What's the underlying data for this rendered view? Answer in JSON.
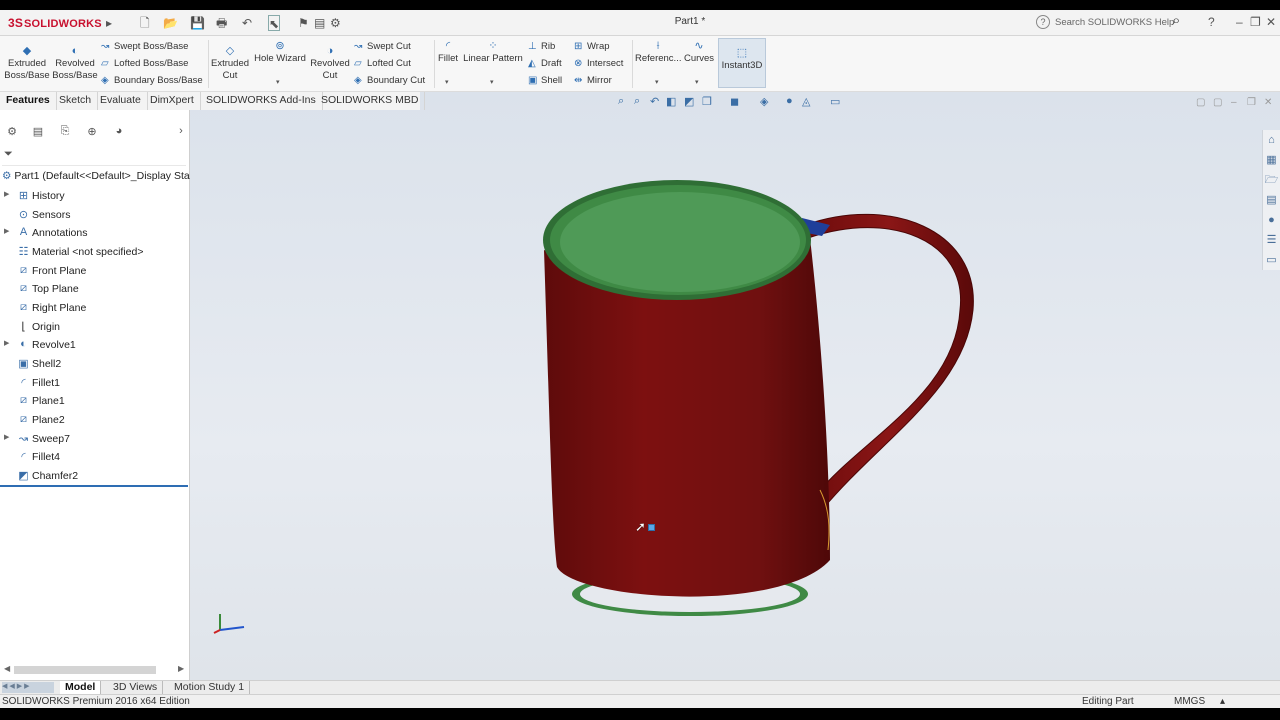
{
  "app": {
    "brand": "SOLIDWORKS",
    "document_title": "Part1 *",
    "help_search_placeholder": "Search SOLIDWORKS Help"
  },
  "ribbon": {
    "extruded_boss": "Extruded Boss/Base",
    "revolved_boss": "Revolved Boss/Base",
    "swept_boss": "Swept Boss/Base",
    "lofted_boss": "Lofted Boss/Base",
    "boundary_boss": "Boundary Boss/Base",
    "extruded_cut": "Extruded Cut",
    "hole_wizard": "Hole Wizard",
    "revolved_cut": "Revolved Cut",
    "swept_cut": "Swept Cut",
    "lofted_cut": "Lofted Cut",
    "boundary_cut": "Boundary Cut",
    "fillet": "Fillet",
    "linear_pattern": "Linear Pattern",
    "rib": "Rib",
    "draft": "Draft",
    "shell": "Shell",
    "wrap": "Wrap",
    "intersect": "Intersect",
    "mirror": "Mirror",
    "reference": "Referenc...",
    "curves": "Curves",
    "instant3d": "Instant3D"
  },
  "tabs": [
    "Features",
    "Sketch",
    "Evaluate",
    "DimXpert",
    "SOLIDWORKS Add-Ins",
    "SOLIDWORKS MBD"
  ],
  "tree": {
    "root": "Part1  (Default<<Default>_Display Sta",
    "items": [
      {
        "label": "History",
        "icon": "history-icon",
        "expandable": true
      },
      {
        "label": "Sensors",
        "icon": "sensor-icon",
        "expandable": false
      },
      {
        "label": "Annotations",
        "icon": "annotation-icon",
        "expandable": true
      },
      {
        "label": "Material <not specified>",
        "icon": "material-icon",
        "expandable": false
      },
      {
        "label": "Front Plane",
        "icon": "plane-icon",
        "expandable": false
      },
      {
        "label": "Top Plane",
        "icon": "plane-icon",
        "expandable": false
      },
      {
        "label": "Right Plane",
        "icon": "plane-icon",
        "expandable": false
      },
      {
        "label": "Origin",
        "icon": "origin-icon",
        "expandable": false
      },
      {
        "label": "Revolve1",
        "icon": "revolve-icon",
        "expandable": true
      },
      {
        "label": "Shell2",
        "icon": "shell-icon",
        "expandable": false
      },
      {
        "label": "Fillet1",
        "icon": "fillet-icon",
        "expandable": false
      },
      {
        "label": "Plane1",
        "icon": "plane-icon",
        "expandable": false
      },
      {
        "label": "Plane2",
        "icon": "plane-icon",
        "expandable": false
      },
      {
        "label": "Sweep7",
        "icon": "sweep-icon",
        "expandable": true
      },
      {
        "label": "Fillet4",
        "icon": "fillet-icon",
        "expandable": false
      },
      {
        "label": "Chamfer2",
        "icon": "chamfer-icon",
        "expandable": false
      }
    ]
  },
  "bottom_tabs": [
    "Model",
    "3D Views",
    "Motion Study 1"
  ],
  "status": {
    "edition": "SOLIDWORKS Premium 2016 x64 Edition",
    "mode": "Editing Part",
    "units": "MMGS"
  },
  "colors": {
    "mug_body": "#7d1010",
    "mug_rim": "#3f8a45",
    "viewport_bg": "#dfe4ea",
    "accent": "#2e6db3"
  }
}
